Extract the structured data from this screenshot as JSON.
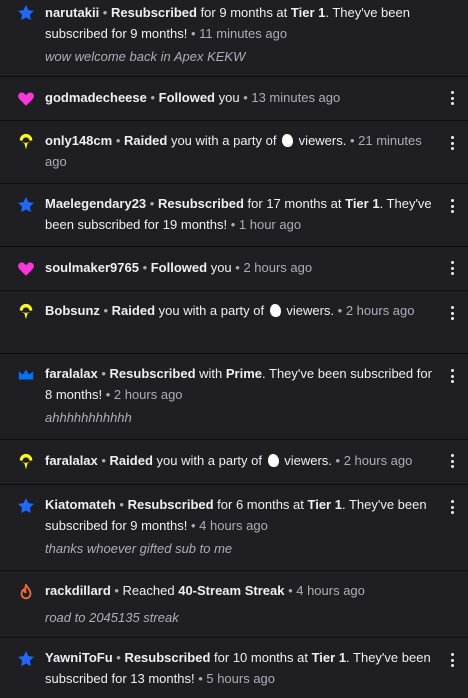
{
  "colors": {
    "sub_star": "#1f69ff",
    "follow_heart": "#ff38db",
    "raid": "#f9f925",
    "prime": "#0072f5",
    "streak": "#f06b3a"
  },
  "items": [
    {
      "icon": "star-icon",
      "user": "narutakii",
      "p1": "Resubscribed",
      "p2": " for 9 months at ",
      "p3": "Tier 1",
      "p4": ". They've been subscribed for 9 months!",
      "sep": " • ",
      "time": "11 minutes ago",
      "msg": "wow welcome back in Apex KEKW"
    },
    {
      "icon": "heart-icon",
      "user": "godmadecheese",
      "p1": "Followed",
      "p2": " you",
      "sep": " • ",
      "time": "13 minutes ago"
    },
    {
      "icon": "raid-icon",
      "user": "only148cm",
      "p1": "Raided",
      "p2": " you with a party of ",
      "p3": " viewers.",
      "sep": " • ",
      "time": "21 minutes ago"
    },
    {
      "icon": "star-icon",
      "user": "Maelegendary23",
      "p1": "Resubscribed",
      "p2": " for 17 months at ",
      "p3": "Tier 1",
      "p4": ". They've been subscribed for 19 months!",
      "sep": " • ",
      "time": "1 hour ago"
    },
    {
      "icon": "heart-icon",
      "user": "soulmaker9765",
      "p1": "Followed",
      "p2": " you",
      "sep": " • ",
      "time": "2 hours ago"
    },
    {
      "icon": "raid-icon",
      "user": "Bobsunz",
      "p1": "Raided",
      "p2": " you with a party of ",
      "p3": " viewers.",
      "sep": " • ",
      "time": "2 hours ago"
    },
    {
      "icon": "crown-icon",
      "user": "faralalax",
      "p1": "Resubscribed",
      "p2": " with ",
      "p3": "Prime",
      "p4": ". They've been subscribed for 8 months!",
      "sep": " • ",
      "time": "2 hours ago",
      "msg": "ahhhhhhhhhhh"
    },
    {
      "icon": "raid-icon",
      "user": "faralalax",
      "p1": "Raided",
      "p2": " you with a party of ",
      "p3": " viewers.",
      "sep": " • ",
      "time": "2 hours ago"
    },
    {
      "icon": "star-icon",
      "user": "Kiatomateh",
      "p1": "Resubscribed",
      "p2": " for 6 months at ",
      "p3": "Tier 1",
      "p4": ". They've been subscribed for 9 months!",
      "sep": " • ",
      "time": "4 hours ago",
      "msg": "thanks whoever gifted sub to me"
    },
    {
      "icon": "flame-icon",
      "user": "rackdillard",
      "p1": "Reached",
      "p2": " ",
      "p3": "40-Stream Streak",
      "sep": " • ",
      "time": "4 hours ago",
      "msg": "road to 2045135 streak"
    },
    {
      "icon": "star-icon",
      "user": "YawniToFu",
      "p1": "Resubscribed",
      "p2": " for 10 months at ",
      "p3": "Tier 1",
      "p4": ". They've been subscribed for 13 months!",
      "sep": " • ",
      "time": "5 hours ago"
    }
  ]
}
